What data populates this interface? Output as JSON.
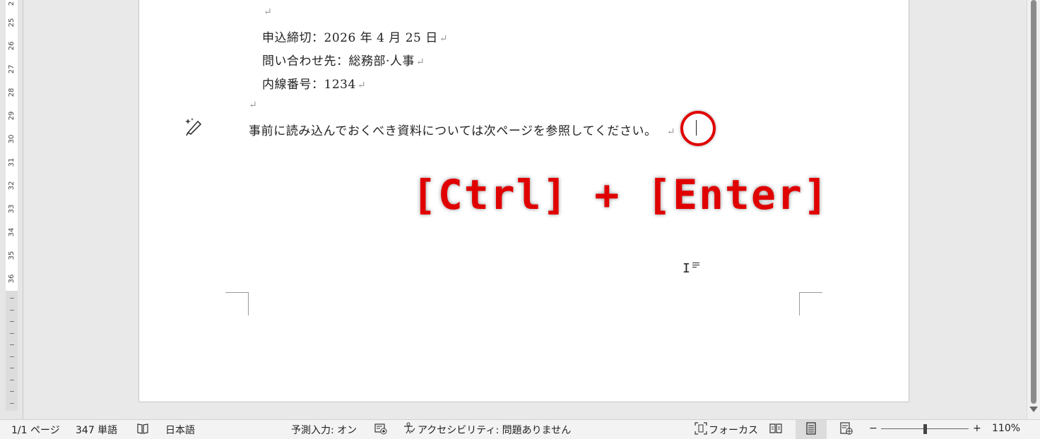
{
  "document": {
    "lines": [
      {
        "text": "",
        "mark": "↵"
      },
      {
        "text": "申込締切：2026 年 4 月 25 日",
        "mark": "↵"
      },
      {
        "text": "問い合わせ先：総務部·人事",
        "mark": "↵"
      },
      {
        "text": "内線番号：1234",
        "mark": "↵"
      },
      {
        "text": "",
        "mark": "↵"
      },
      {
        "text": "事前に読み込んでおくべき資料については次ページを参照してください。",
        "mark": "↵"
      }
    ]
  },
  "annotation": {
    "shortcut": "[Ctrl] + [Enter]",
    "highlight_color": "#e00000"
  },
  "ruler": {
    "labels": [
      "2",
      "25",
      "26",
      "27",
      "28",
      "29",
      "30",
      "31",
      "32",
      "33",
      "34",
      "35",
      "36"
    ]
  },
  "statusbar": {
    "page": "1/1 ページ",
    "words": "347 単語",
    "language": "日本語",
    "predictive": "予測入力: オン",
    "accessibility": "アクセシビリティ: 問題ありません",
    "focus": "フォーカス",
    "zoom_minus": "−",
    "zoom_plus": "+",
    "zoom": "110%",
    "zoom_level_percent": 110
  }
}
